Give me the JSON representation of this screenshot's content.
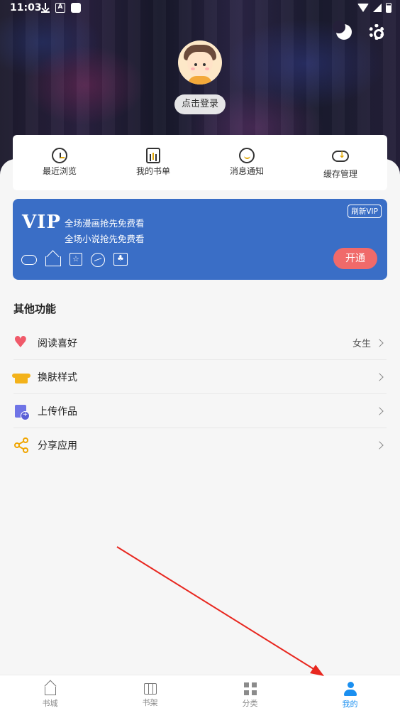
{
  "status_bar": {
    "time": "11:03"
  },
  "profile": {
    "login_label": "点击登录"
  },
  "quick_actions": [
    {
      "label": "最近浏览",
      "icon": "history-icon"
    },
    {
      "label": "我的书单",
      "icon": "booklist-icon"
    },
    {
      "label": "消息通知",
      "icon": "message-icon"
    },
    {
      "label": "缓存管理",
      "icon": "cloud-download-icon"
    }
  ],
  "vip": {
    "title": "VIP",
    "line1": "全场漫画抢先免费看",
    "line2": "全场小说抢先免费看",
    "refresh_label": "刷新VIP",
    "open_label": "开通",
    "bg_color": "#3a6ec6",
    "button_color": "#f06a6a"
  },
  "other_functions": {
    "title": "其他功能",
    "items": [
      {
        "label": "阅读喜好",
        "value": "女生",
        "icon": "heart-icon"
      },
      {
        "label": "换肤样式",
        "value": "",
        "icon": "tshirt-icon"
      },
      {
        "label": "上传作品",
        "value": "",
        "icon": "upload-document-icon"
      },
      {
        "label": "分享应用",
        "value": "",
        "icon": "share-icon"
      }
    ]
  },
  "bottom_nav": {
    "active": "我的",
    "active_color": "#1a8ff0",
    "items": [
      {
        "label": "书城",
        "icon": "home-icon"
      },
      {
        "label": "书架",
        "icon": "bookshelf-icon"
      },
      {
        "label": "分类",
        "icon": "grid-icon"
      },
      {
        "label": "我的",
        "icon": "user-icon"
      }
    ]
  }
}
